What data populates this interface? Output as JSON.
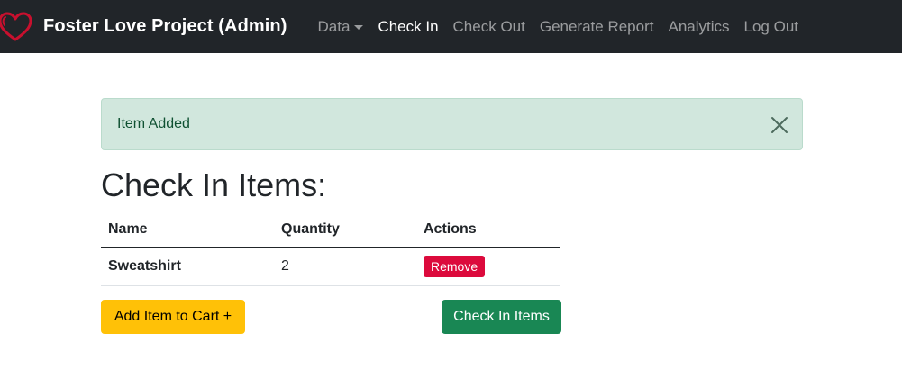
{
  "colors": {
    "navbar_bg": "#212529",
    "alert_bg": "#d1e7dd",
    "alert_text": "#0f5132",
    "remove_button": "#dc0a3c",
    "add_button": "#ffc107",
    "checkin_button": "#198754",
    "logo": "#c8102e"
  },
  "navbar": {
    "brand": "Foster Love Project (Admin)",
    "logo_icon": "heart-outline-icon",
    "links": [
      {
        "label": "Data",
        "dropdown": true,
        "active": false
      },
      {
        "label": "Check In",
        "active": true
      },
      {
        "label": "Check Out",
        "active": false
      },
      {
        "label": "Generate Report",
        "active": false
      },
      {
        "label": "Analytics",
        "active": false
      },
      {
        "label": "Log Out",
        "active": false
      }
    ]
  },
  "alert": {
    "message": "Item Added",
    "close_icon": "close-icon"
  },
  "page": {
    "title": "Check In Items:"
  },
  "table": {
    "headers": [
      "Name",
      "Quantity",
      "Actions"
    ],
    "rows": [
      {
        "name": "Sweatshirt",
        "quantity": "2",
        "action": "Remove"
      }
    ]
  },
  "actions": {
    "add_label": "Add Item to Cart +",
    "checkin_label": "Check In Items"
  }
}
